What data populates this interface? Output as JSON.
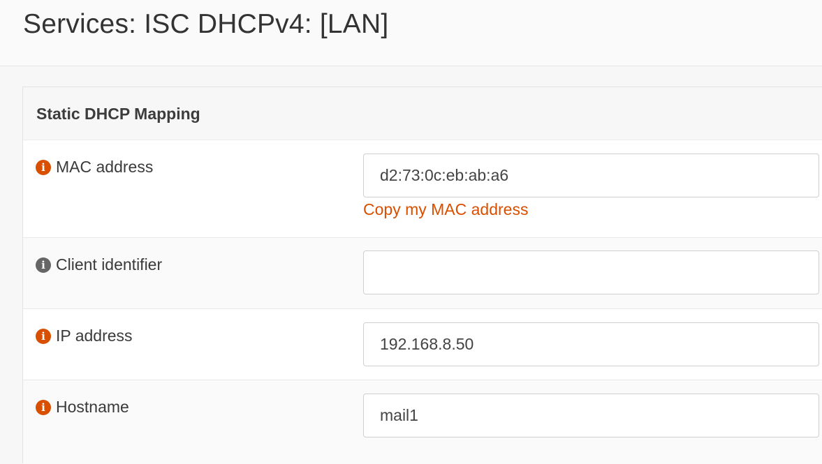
{
  "header": {
    "title": "Services: ISC DHCPv4: [LAN]"
  },
  "panel": {
    "title": "Static DHCP Mapping"
  },
  "fields": {
    "mac": {
      "label": "MAC address",
      "value": "d2:73:0c:eb:ab:a6",
      "copy_link": "Copy my MAC address",
      "icon": "info-icon",
      "icon_color": "#d94f00"
    },
    "client_id": {
      "label": "Client identifier",
      "value": "",
      "icon": "info-icon",
      "icon_color": "#666666"
    },
    "ip": {
      "label": "IP address",
      "value": "192.168.8.50",
      "icon": "info-icon",
      "icon_color": "#d94f00"
    },
    "hostname": {
      "label": "Hostname",
      "value": "mail1",
      "icon": "info-icon",
      "icon_color": "#d94f00"
    }
  }
}
